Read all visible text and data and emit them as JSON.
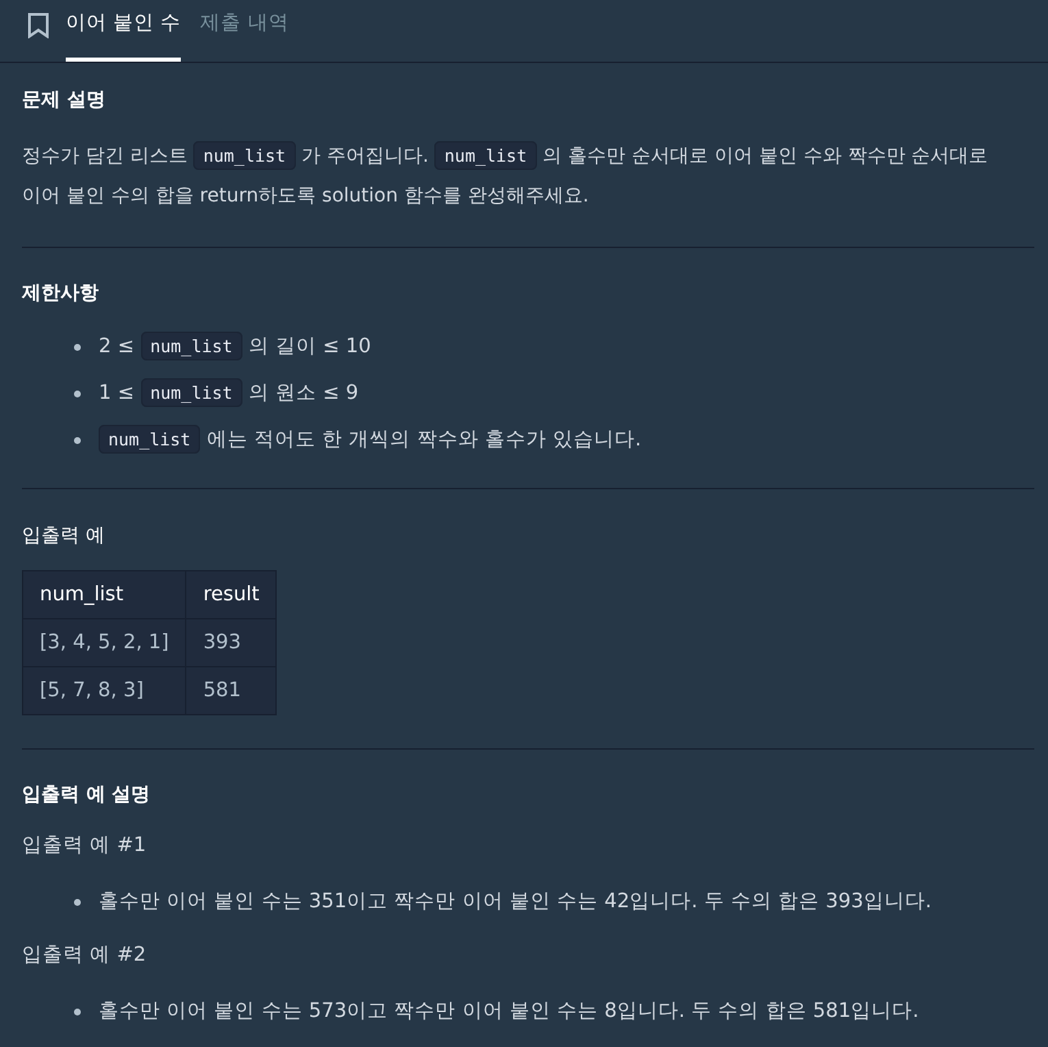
{
  "header": {
    "tabs": [
      {
        "label": "이어 붙인 수",
        "selected": true
      },
      {
        "label": "제출 내역",
        "selected": false
      }
    ]
  },
  "sections": [
    {
      "kind": "text",
      "title": "문제 설명",
      "paragraphs": [
        [
          {
            "kind": "text",
            "text": "정수가 담긴 리스트 "
          },
          {
            "kind": "code",
            "text": "num_list"
          },
          {
            "kind": "text",
            "text": " 가 주어집니다. "
          },
          {
            "kind": "code",
            "text": "num_list"
          },
          {
            "kind": "text",
            "text": " 의 홀수만 순서대로 이어 붙인 수와 짝수만 순서대로 이어 붙인 수의 합을 return하도록 solution 함수를 완성해주세요."
          }
        ]
      ]
    },
    {
      "kind": "list",
      "title": "제한사항",
      "items": [
        [
          {
            "kind": "text",
            "text": "2 ≤ "
          },
          {
            "kind": "code",
            "text": "num_list"
          },
          {
            "kind": "text",
            "text": " 의 길이 ≤ 10"
          }
        ],
        [
          {
            "kind": "text",
            "text": "1 ≤ "
          },
          {
            "kind": "code",
            "text": "num_list"
          },
          {
            "kind": "text",
            "text": " 의 원소 ≤ 9"
          }
        ],
        [
          {
            "kind": "code",
            "text": "num_list"
          },
          {
            "kind": "text",
            "text": " 에는 적어도 한 개씩의 짝수와 홀수가 있습니다."
          }
        ]
      ]
    },
    {
      "kind": "table",
      "title": "입출력 예",
      "table": {
        "columns": [
          "num_list",
          "result"
        ],
        "rows": [
          [
            "[3, 4, 5, 2, 1]",
            "393"
          ],
          [
            "[5, 7, 8, 3]",
            "581"
          ]
        ]
      }
    },
    {
      "kind": "examples",
      "title": "입출력 예 설명",
      "examples": [
        {
          "label": "입출력 예 #1",
          "items": [
            [
              {
                "kind": "text",
                "text": "홀수만 이어 붙인 수는 351이고 짝수만 이어 붙인 수는 42입니다. 두 수의 합은 393입니다."
              }
            ]
          ]
        },
        {
          "label": "입출력 예 #2",
          "items": [
            [
              {
                "kind": "text",
                "text": "홀수만 이어 붙인 수는 573이고 짝수만 이어 붙인 수는 8입니다. 두 수의 합은 581입니다."
              }
            ]
          ]
        }
      ]
    }
  ]
}
